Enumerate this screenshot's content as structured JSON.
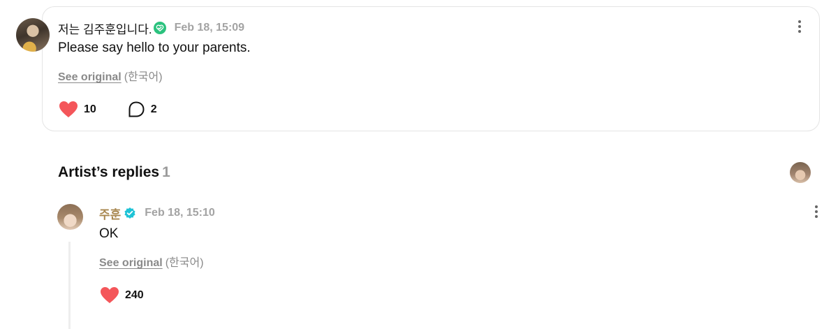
{
  "post": {
    "author": "저는 김주훈입니다.",
    "timestamp": "Feb 18, 15:09",
    "text": "Please say hello to your parents.",
    "see_original_label": "See original",
    "language": "(한국어)",
    "likes": "10",
    "comments": "2",
    "badge_icon": "verified-check-icon",
    "badge_color": "#2bc27e"
  },
  "replies_section": {
    "title": "Artist’s replies",
    "count": "1"
  },
  "reply": {
    "author": "주훈",
    "author_color": "#a8874f",
    "timestamp": "Feb 18, 15:10",
    "text": "OK",
    "see_original_label": "See original",
    "language": "(한국어)",
    "likes": "240",
    "badge_icon": "verified-badge-icon",
    "badge_color": "#1fc3d6"
  },
  "colors": {
    "heart": "#f4565a",
    "muted_text": "#a3a3a3",
    "card_border": "#e4e4e4"
  }
}
